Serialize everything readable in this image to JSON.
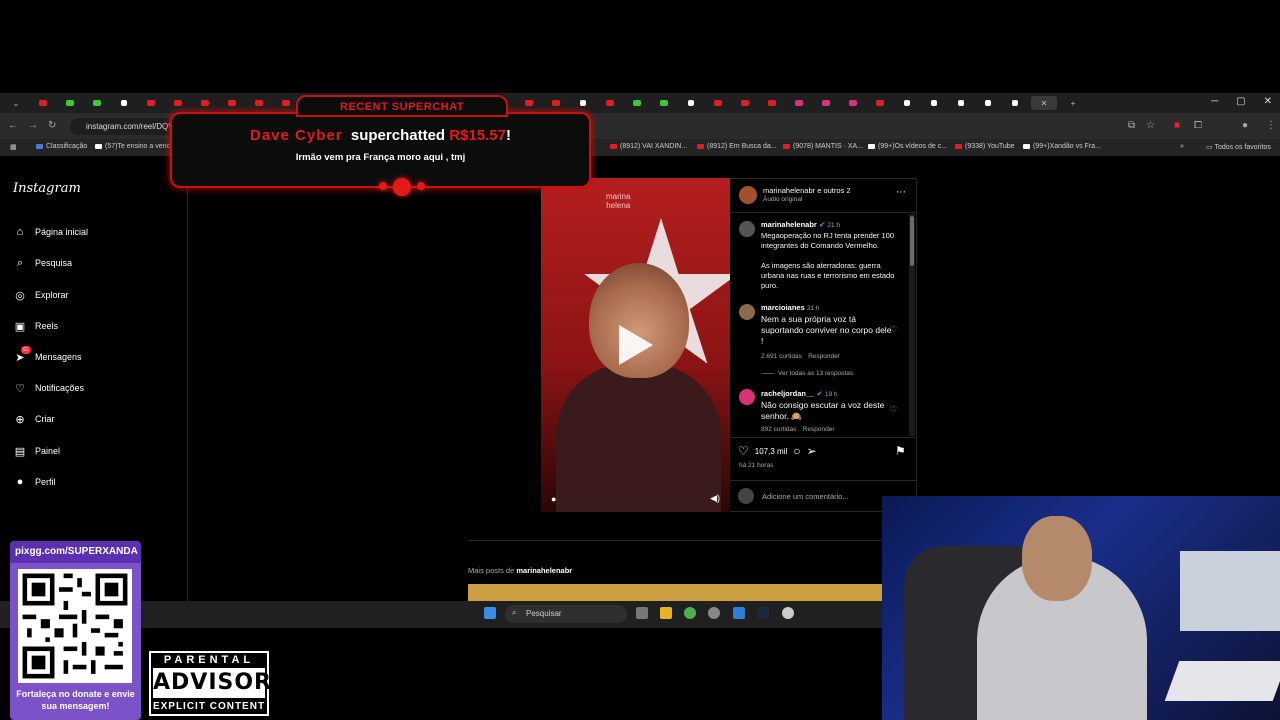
{
  "browser": {
    "url": "instagram.com/reel/DQV",
    "bookmarks": [
      {
        "label": "Classificação"
      },
      {
        "label": "(57)Te ensino a venc..."
      },
      {
        "label": "(8912) VAI XANDIN..."
      },
      {
        "label": "(8912) Em Busca da..."
      },
      {
        "label": "(9078) MANTIS · XA..."
      },
      {
        "label": "(99+)Os vídeos de c..."
      },
      {
        "label": "(9338) YouTube"
      },
      {
        "label": "(99+)Xandão vs Fra..."
      },
      {
        "label": "Todos os favoritos"
      }
    ]
  },
  "instagram": {
    "logo": "Instagram",
    "nav": [
      {
        "label": "Página inicial",
        "icon": "home-icon"
      },
      {
        "label": "Pesquisa",
        "icon": "search-icon"
      },
      {
        "label": "Explorar",
        "icon": "compass-icon"
      },
      {
        "label": "Reels",
        "icon": "reels-icon"
      },
      {
        "label": "Mensagens",
        "icon": "messenger-icon",
        "badge": "91"
      },
      {
        "label": "Notificações",
        "icon": "heart-icon"
      },
      {
        "label": "Criar",
        "icon": "plus-icon"
      },
      {
        "label": "Painel",
        "icon": "chart-icon"
      },
      {
        "label": "Perfil",
        "icon": "avatar-icon"
      }
    ],
    "video_brand": "marina\nhelena",
    "post": {
      "header_user": "marinahelenabr e outros 2",
      "audio": "Áudio original",
      "caption_user": "marinahelenabr",
      "caption_time": "21 h",
      "caption_1": "Megaoperação no RJ tenta prender 100 integrantes do Comando Vermelho.",
      "caption_2": "As imagens são aterradoras: guerra urbana nas ruas e terrorismo em estado puro.",
      "comments": [
        {
          "user": "marcioianes",
          "time": "21 h",
          "text": "Nem a sua própria voz tá suportando conviver no corpo dele !",
          "likes": "2.691 curtidas",
          "reply": "Responder",
          "replies": "Ver todas as 13 respostas"
        },
        {
          "user": "racheljordan__",
          "time": "19 h",
          "text": "Não consigo escutar a voz deste senhor. 🙉",
          "likes": "892 curtidas",
          "reply": "Responder"
        }
      ],
      "likes": "107,3 mil",
      "posted": "há 21 horas",
      "comment_placeholder": "Adicione um comentário..."
    },
    "more_posts_prefix": "Mais posts de ",
    "more_posts_user": "marinahelenabr"
  },
  "taskbar": {
    "search": "Pesquisar"
  },
  "superchat": {
    "title": "RECENT SUPERCHAT",
    "name": "Dave Cyber",
    "verb": "superchatted",
    "amount": "R$15.57",
    "bang": "!",
    "message": "Irmão vem pra França moro aqui , tmj"
  },
  "donate": {
    "url": "pixgg.com/SUPERXANDA",
    "caption": "Fortaleça no donate e envie sua mensagem!"
  },
  "advisory": {
    "top": "PARENTAL",
    "mid": "ADVISORY",
    "bottom": "EXPLICIT CONTENT"
  },
  "colors": {
    "accent_red": "#e21a1a",
    "ig_badge": "#ff3040",
    "donate_purple": "#7b52c8"
  }
}
